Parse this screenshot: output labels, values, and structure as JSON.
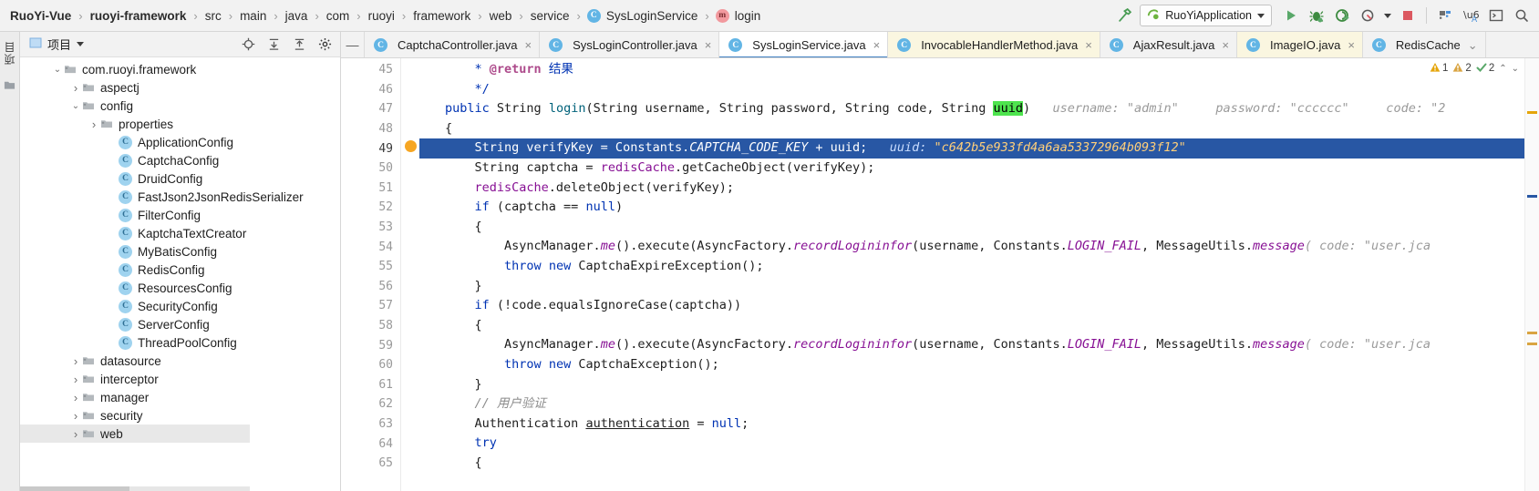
{
  "breadcrumb": {
    "items": [
      {
        "label": "RuoYi-Vue",
        "bold": true,
        "icon": null
      },
      {
        "label": "ruoyi-framework",
        "bold": true,
        "icon": null
      },
      {
        "label": "src",
        "bold": false,
        "icon": null
      },
      {
        "label": "main",
        "bold": false,
        "icon": null
      },
      {
        "label": "java",
        "bold": false,
        "icon": null
      },
      {
        "label": "com",
        "bold": false,
        "icon": null
      },
      {
        "label": "ruoyi",
        "bold": false,
        "icon": null
      },
      {
        "label": "framework",
        "bold": false,
        "icon": null
      },
      {
        "label": "web",
        "bold": false,
        "icon": null
      },
      {
        "label": "service",
        "bold": false,
        "icon": null
      },
      {
        "label": "SysLoginService",
        "bold": false,
        "icon": "class-badge"
      },
      {
        "label": "login",
        "bold": false,
        "icon": "method-badge"
      }
    ],
    "separator": "›"
  },
  "toolbar": {
    "build_icon": "hammer-icon",
    "run_config": "RuoYiApplication",
    "run_config_icon": "spring-boot-icon",
    "dropdown_caret": "▾",
    "run_label": "run-icon",
    "debug_label": "debug-icon",
    "run_coverage_label": "run-with-coverage-icon",
    "profiler_label": "profiler-icon",
    "stop_label": "stop-icon",
    "more_label": "services-icon",
    "translate_label": "translate-icon",
    "terminal_label": "terminal-icon",
    "search_label": "search-icon"
  },
  "leftstrip": {
    "vtab_label": "项目",
    "bookmark_icon": "folder-icon"
  },
  "project_panel": {
    "title": "项目",
    "title_icon": "project-icon",
    "caret": "▾",
    "actions": [
      {
        "name": "locate-icon",
        "glyph": "⊕"
      },
      {
        "name": "expand-all-icon",
        "glyph": "⤓"
      },
      {
        "name": "collapse-all-icon",
        "glyph": "⤒"
      },
      {
        "name": "settings-gear-icon",
        "glyph": "⚙"
      }
    ],
    "tree": [
      {
        "label": "com.ruoyi.framework",
        "type": "folder",
        "indent": 1,
        "arrow": "down",
        "selected": false
      },
      {
        "label": "aspectj",
        "type": "folder",
        "indent": 2,
        "arrow": "right",
        "selected": false
      },
      {
        "label": "config",
        "type": "folder",
        "indent": 2,
        "arrow": "down",
        "selected": false
      },
      {
        "label": "properties",
        "type": "folder",
        "indent": 3,
        "arrow": "right",
        "selected": false
      },
      {
        "label": "ApplicationConfig",
        "type": "class",
        "indent": 4,
        "arrow": "none",
        "selected": false
      },
      {
        "label": "CaptchaConfig",
        "type": "class",
        "indent": 4,
        "arrow": "none",
        "selected": false
      },
      {
        "label": "DruidConfig",
        "type": "class",
        "indent": 4,
        "arrow": "none",
        "selected": false
      },
      {
        "label": "FastJson2JsonRedisSerializer",
        "type": "class",
        "indent": 4,
        "arrow": "none",
        "selected": false
      },
      {
        "label": "FilterConfig",
        "type": "class",
        "indent": 4,
        "arrow": "none",
        "selected": false
      },
      {
        "label": "KaptchaTextCreator",
        "type": "class",
        "indent": 4,
        "arrow": "none",
        "selected": false
      },
      {
        "label": "MyBatisConfig",
        "type": "class",
        "indent": 4,
        "arrow": "none",
        "selected": false
      },
      {
        "label": "RedisConfig",
        "type": "class",
        "indent": 4,
        "arrow": "none",
        "selected": false
      },
      {
        "label": "ResourcesConfig",
        "type": "class",
        "indent": 4,
        "arrow": "none",
        "selected": false
      },
      {
        "label": "SecurityConfig",
        "type": "class",
        "indent": 4,
        "arrow": "none",
        "selected": false
      },
      {
        "label": "ServerConfig",
        "type": "class",
        "indent": 4,
        "arrow": "none",
        "selected": false
      },
      {
        "label": "ThreadPoolConfig",
        "type": "class",
        "indent": 4,
        "arrow": "none",
        "selected": false
      },
      {
        "label": "datasource",
        "type": "folder",
        "indent": 2,
        "arrow": "right",
        "selected": false
      },
      {
        "label": "interceptor",
        "type": "folder",
        "indent": 2,
        "arrow": "right",
        "selected": false
      },
      {
        "label": "manager",
        "type": "folder",
        "indent": 2,
        "arrow": "right",
        "selected": false
      },
      {
        "label": "security",
        "type": "folder",
        "indent": 2,
        "arrow": "right",
        "selected": false
      },
      {
        "label": "web",
        "type": "folder",
        "indent": 2,
        "arrow": "right",
        "selected": true
      }
    ]
  },
  "editor_tabs": {
    "collapse_icon": "—",
    "overflow_caret": "⌄",
    "tabs": [
      {
        "label": "CaptchaController.java",
        "icon": "java-class-icon",
        "active": false,
        "modified": false,
        "close": "×"
      },
      {
        "label": "SysLoginController.java",
        "icon": "java-class-icon",
        "active": false,
        "modified": false,
        "close": "×"
      },
      {
        "label": "SysLoginService.java",
        "icon": "java-class-icon",
        "active": true,
        "modified": false,
        "close": "×"
      },
      {
        "label": "InvocableHandlerMethod.java",
        "icon": "java-class-icon",
        "active": false,
        "modified": true,
        "close": "×"
      },
      {
        "label": "AjaxResult.java",
        "icon": "java-class-icon",
        "active": false,
        "modified": false,
        "close": "×"
      },
      {
        "label": "ImageIO.java",
        "icon": "java-class-icon",
        "active": false,
        "modified": true,
        "close": "×"
      },
      {
        "label": "RedisCache",
        "icon": "java-class-icon",
        "active": false,
        "modified": false,
        "close": ""
      }
    ]
  },
  "inspection_widget": {
    "warning_icon": "⚠",
    "warning_count": "1",
    "weak_warning_icon": "⚠",
    "weak_warning_count": "2",
    "check_icon": "✓",
    "check_count": "2",
    "up_caret": "⌃",
    "down_caret": "⌄"
  },
  "code": {
    "first_line_number": 45,
    "lines": [
      {
        "n": 45,
        "fold": "",
        "current": false,
        "breakpoint": false,
        "tokens": [
          {
            "t": "    ",
            "c": "plain"
          },
          {
            "t": "* ",
            "c": "doc"
          },
          {
            "t": "@return",
            "c": "cmt-tag"
          },
          {
            "t": " 结果",
            "c": "doc"
          }
        ]
      },
      {
        "n": 46,
        "fold": "end",
        "current": false,
        "breakpoint": false,
        "tokens": [
          {
            "t": "    */",
            "c": "doc"
          }
        ]
      },
      {
        "n": 47,
        "fold": "",
        "current": false,
        "breakpoint": false,
        "tokens": [
          {
            "t": "",
            "c": "plain"
          },
          {
            "t": "public",
            "c": "kw"
          },
          {
            "t": " String ",
            "c": "plain"
          },
          {
            "t": "login",
            "c": "mth"
          },
          {
            "t": "(String username, String password, String code, String ",
            "c": "plain"
          },
          {
            "t": "uuid",
            "c": "uuid-hl"
          },
          {
            "t": ")",
            "c": "plain"
          },
          {
            "t": "   username: ",
            "c": "hint"
          },
          {
            "t": "\"admin\"",
            "c": "hint"
          },
          {
            "t": "     password: ",
            "c": "hint"
          },
          {
            "t": "\"cccccc\"",
            "c": "hint"
          },
          {
            "t": "     code: ",
            "c": "hint"
          },
          {
            "t": "\"2",
            "c": "hint"
          }
        ]
      },
      {
        "n": 48,
        "fold": "start",
        "current": false,
        "breakpoint": false,
        "tokens": [
          {
            "t": "{",
            "c": "plain"
          }
        ]
      },
      {
        "n": 49,
        "fold": "",
        "current": true,
        "breakpoint": true,
        "tokens": [
          {
            "t": "    String verifyKey = Constants.",
            "c": "plain"
          },
          {
            "t": "CAPTCHA_CODE_KEY",
            "c": "stc"
          },
          {
            "t": " + ",
            "c": "plain"
          },
          {
            "t": "uuid",
            "c": "fld"
          },
          {
            "t": ";",
            "c": "plain"
          },
          {
            "t": "   uuid: ",
            "c": "hint"
          },
          {
            "t": "\"c642b5e933fd4a6aa53372964b093f12\"",
            "c": "hintval"
          }
        ]
      },
      {
        "n": 50,
        "fold": "",
        "current": false,
        "breakpoint": false,
        "tokens": [
          {
            "t": "    String captcha = ",
            "c": "plain"
          },
          {
            "t": "redisCache",
            "c": "fld"
          },
          {
            "t": ".getCacheObject(verifyKey);",
            "c": "plain"
          }
        ]
      },
      {
        "n": 51,
        "fold": "",
        "current": false,
        "breakpoint": false,
        "tokens": [
          {
            "t": "    ",
            "c": "plain"
          },
          {
            "t": "redisCache",
            "c": "fld"
          },
          {
            "t": ".deleteObject(verifyKey);",
            "c": "plain"
          }
        ]
      },
      {
        "n": 52,
        "fold": "",
        "current": false,
        "breakpoint": false,
        "tokens": [
          {
            "t": "    ",
            "c": "plain"
          },
          {
            "t": "if",
            "c": "kw"
          },
          {
            "t": " (captcha == ",
            "c": "plain"
          },
          {
            "t": "null",
            "c": "kw"
          },
          {
            "t": ")",
            "c": "plain"
          }
        ]
      },
      {
        "n": 53,
        "fold": "start",
        "current": false,
        "breakpoint": false,
        "tokens": [
          {
            "t": "    {",
            "c": "plain"
          }
        ]
      },
      {
        "n": 54,
        "fold": "",
        "current": false,
        "breakpoint": false,
        "tokens": [
          {
            "t": "        AsyncManager.",
            "c": "plain"
          },
          {
            "t": "me",
            "c": "stc"
          },
          {
            "t": "().execute(AsyncFactory.",
            "c": "plain"
          },
          {
            "t": "recordLogininfor",
            "c": "stc"
          },
          {
            "t": "(username, Constants.",
            "c": "plain"
          },
          {
            "t": "LOGIN_FAIL",
            "c": "stc"
          },
          {
            "t": ", MessageUtils.",
            "c": "plain"
          },
          {
            "t": "message",
            "c": "stc"
          },
          {
            "t": "( code: ",
            "c": "hint"
          },
          {
            "t": "\"user.j",
            "c": "hint"
          },
          {
            "t": "c",
            "c": "hint"
          },
          {
            "t": "a",
            "c": "hint"
          }
        ]
      },
      {
        "n": 55,
        "fold": "",
        "current": false,
        "breakpoint": false,
        "tokens": [
          {
            "t": "        ",
            "c": "plain"
          },
          {
            "t": "throw",
            "c": "kw"
          },
          {
            "t": " ",
            "c": "plain"
          },
          {
            "t": "new",
            "c": "kw"
          },
          {
            "t": " CaptchaExpireException();",
            "c": "plain"
          }
        ]
      },
      {
        "n": 56,
        "fold": "end",
        "current": false,
        "breakpoint": false,
        "tokens": [
          {
            "t": "    }",
            "c": "plain"
          }
        ]
      },
      {
        "n": 57,
        "fold": "",
        "current": false,
        "breakpoint": false,
        "tokens": [
          {
            "t": "    ",
            "c": "plain"
          },
          {
            "t": "if",
            "c": "kw"
          },
          {
            "t": " (!code.equalsIgnoreCase(captcha))",
            "c": "plain"
          }
        ]
      },
      {
        "n": 58,
        "fold": "start",
        "current": false,
        "breakpoint": false,
        "tokens": [
          {
            "t": "    {",
            "c": "plain"
          }
        ]
      },
      {
        "n": 59,
        "fold": "",
        "current": false,
        "breakpoint": false,
        "tokens": [
          {
            "t": "        AsyncManager.",
            "c": "plain"
          },
          {
            "t": "me",
            "c": "stc"
          },
          {
            "t": "().execute(AsyncFactory.",
            "c": "plain"
          },
          {
            "t": "recordLogininfor",
            "c": "stc"
          },
          {
            "t": "(username, Constants.",
            "c": "plain"
          },
          {
            "t": "LOGIN_FAIL",
            "c": "stc"
          },
          {
            "t": ", MessageUtils.",
            "c": "plain"
          },
          {
            "t": "message",
            "c": "stc"
          },
          {
            "t": "( code: ",
            "c": "hint"
          },
          {
            "t": "\"user.jca",
            "c": "hint"
          }
        ]
      },
      {
        "n": 60,
        "fold": "",
        "current": false,
        "breakpoint": false,
        "tokens": [
          {
            "t": "        ",
            "c": "plain"
          },
          {
            "t": "throw",
            "c": "kw"
          },
          {
            "t": " ",
            "c": "plain"
          },
          {
            "t": "new",
            "c": "kw"
          },
          {
            "t": " CaptchaException();",
            "c": "plain"
          }
        ]
      },
      {
        "n": 61,
        "fold": "end",
        "current": false,
        "breakpoint": false,
        "tokens": [
          {
            "t": "    }",
            "c": "plain"
          }
        ]
      },
      {
        "n": 62,
        "fold": "",
        "current": false,
        "breakpoint": false,
        "tokens": [
          {
            "t": "    // 用户验证",
            "c": "cmt"
          }
        ]
      },
      {
        "n": 63,
        "fold": "",
        "current": false,
        "breakpoint": false,
        "tokens": [
          {
            "t": "    Authentication ",
            "c": "plain"
          },
          {
            "t": "authentication",
            "c": "underline"
          },
          {
            "t": " = ",
            "c": "plain"
          },
          {
            "t": "null",
            "c": "kw"
          },
          {
            "t": ";",
            "c": "plain"
          }
        ]
      },
      {
        "n": 64,
        "fold": "",
        "current": false,
        "breakpoint": false,
        "tokens": [
          {
            "t": "    ",
            "c": "plain"
          },
          {
            "t": "try",
            "c": "kw"
          }
        ]
      },
      {
        "n": 65,
        "fold": "",
        "current": false,
        "breakpoint": false,
        "tokens": [
          {
            "t": "    {",
            "c": "plain"
          }
        ]
      }
    ]
  }
}
